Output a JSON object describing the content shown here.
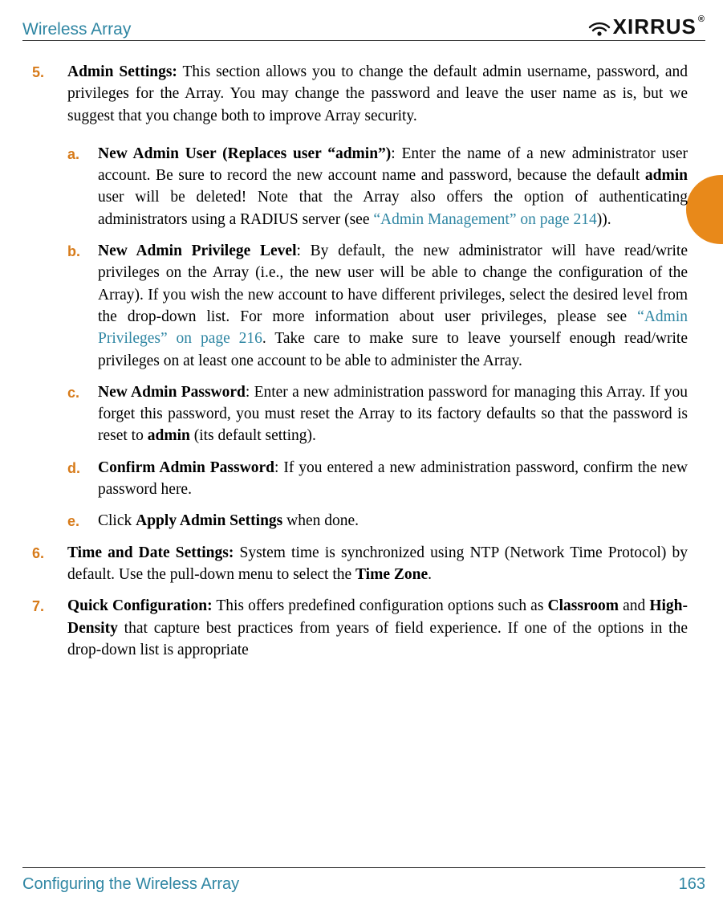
{
  "header": {
    "title": "Wireless Array",
    "logo_text": "XIRRUS"
  },
  "footer": {
    "section": "Configuring the Wireless Array",
    "page": "163"
  },
  "items": [
    {
      "num": "5.",
      "lead_bold": "Admin Settings:",
      "lead_rest": " This section allows you to change the default admin username, password, and privileges for the Array. You may change the password and leave the user name as is, but we suggest that you change both to improve Array security.",
      "subs": [
        {
          "let": "a.",
          "title": "New Admin User (Replaces user “admin”)",
          "pre": ": Enter the name of a new administrator user account. Be sure to record the new account name and password, because the default ",
          "mid_bold": "admin",
          "post_mid": " user will be deleted! Note that the Array also offers the option of authenticating administrators using a RADIUS server (see ",
          "link": "“Admin Management” on page 214",
          "post": "))."
        },
        {
          "let": "b.",
          "title": "New Admin Privilege Level",
          "pre": ": By default, the new administrator will have read/write privileges on the Array (i.e., the new user will be able to change the configuration of the Array). If you wish the new account to have different privileges, select the desired level from the drop-down list. For more information about user privileges, please see ",
          "link": "“Admin Privileges” on page 216",
          "post": ". Take care to make sure to leave yourself enough read/write privileges on at least one account to be able to administer the Array."
        },
        {
          "let": "c.",
          "title": "New Admin Password",
          "pre": ": Enter a new administration password for managing this Array. If you forget this password, you must reset the Array to its factory defaults so that the password is reset to ",
          "mid_bold": "admin",
          "post": " (its default setting)."
        },
        {
          "let": "d.",
          "title": "Confirm Admin Password",
          "pre": ": If you entered a new administration password, confirm the new password here."
        },
        {
          "let": "e.",
          "pre": "Click ",
          "mid_bold": "Apply Admin Settings",
          "post": " when done."
        }
      ]
    },
    {
      "num": "6.",
      "lead_bold": "Time and Date Settings:",
      "lead_rest_pre": " System time is synchronized using NTP (Network Time Protocol) by default. Use the pull-down menu to select the ",
      "lead_rest_bold": "Time Zone",
      "lead_rest_post": "."
    },
    {
      "num": "7.",
      "lead_bold": "Quick Configuration:",
      "lead_rest_pre": " This offers predefined configuration options such as ",
      "lead_rest_bold": "Classroom",
      "lead_rest_mid": " and ",
      "lead_rest_bold2": "High-Density",
      "lead_rest_post": " that capture best practices from years of field experience. If one of the options in the drop-down list is appropriate"
    }
  ]
}
